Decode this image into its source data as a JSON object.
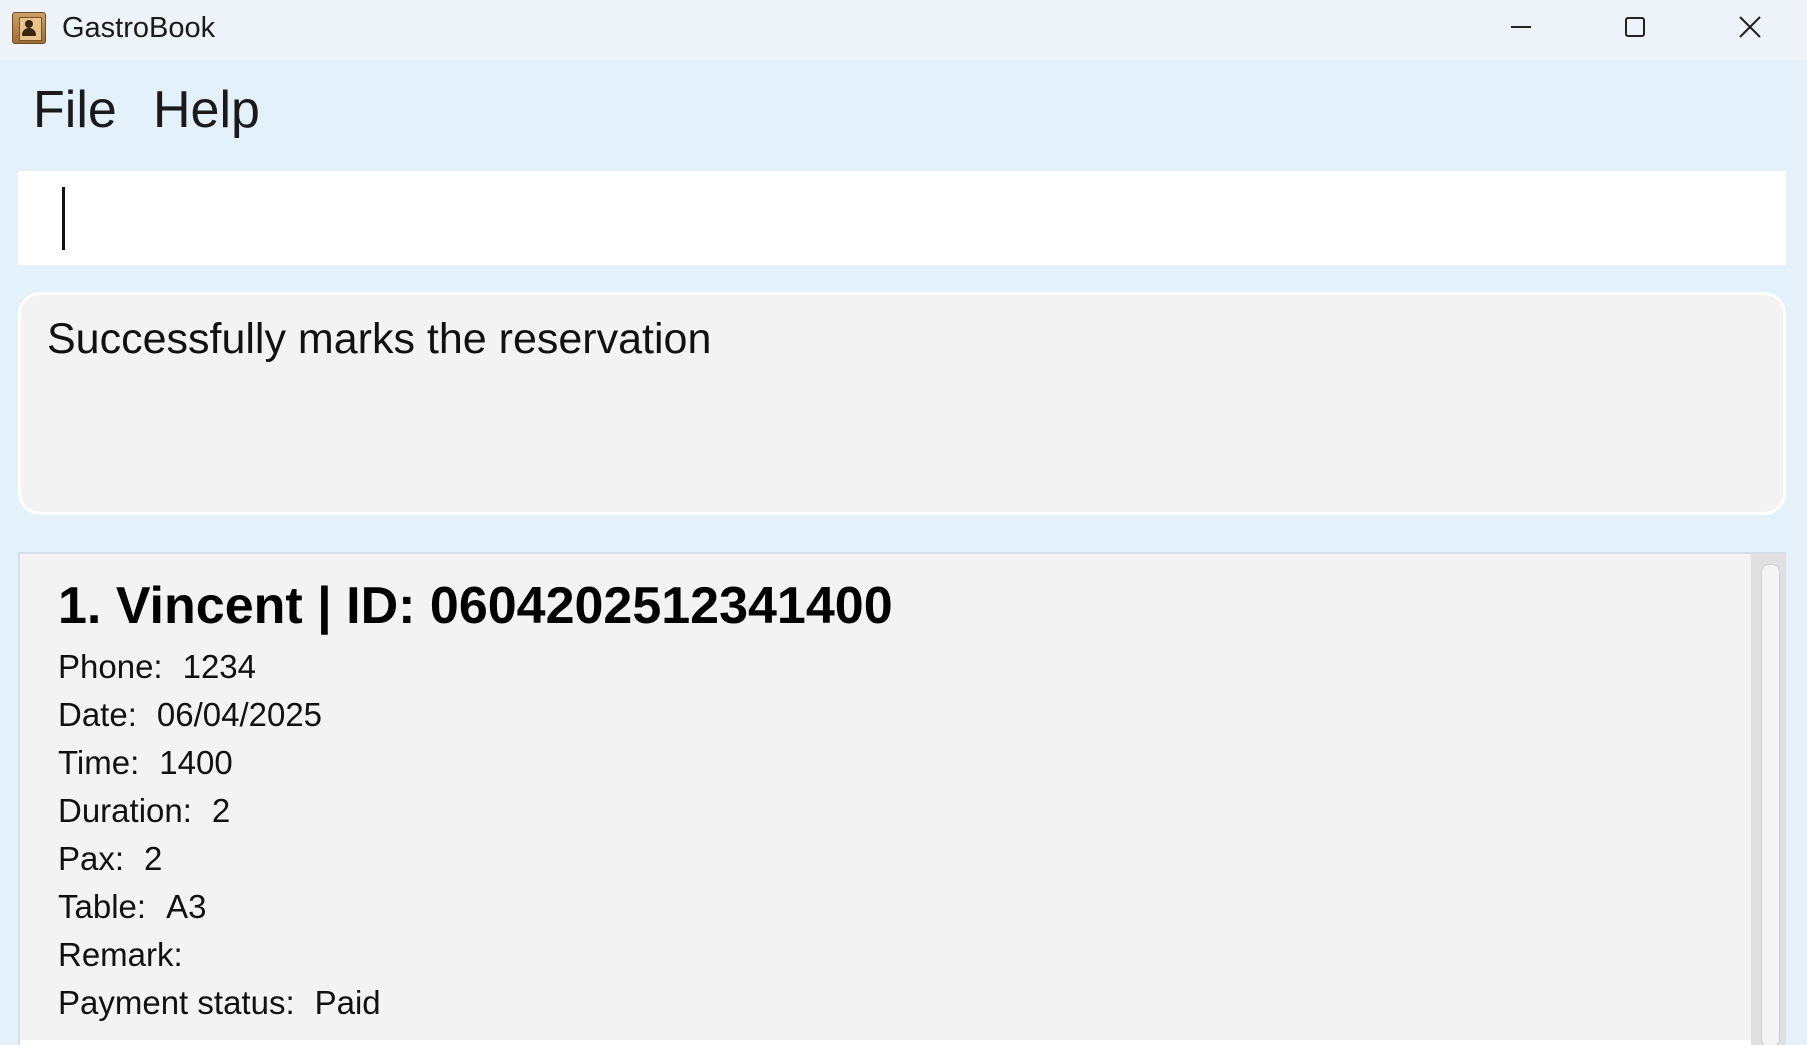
{
  "window": {
    "title": "GastroBook",
    "app_icon": "address-book-icon",
    "controls": [
      "minimize-icon",
      "maximize-icon",
      "close-icon"
    ]
  },
  "menu": {
    "items": [
      {
        "label": "File"
      },
      {
        "label": "Help"
      }
    ]
  },
  "command": {
    "value": "",
    "placeholder": ""
  },
  "result": {
    "message": "Successfully marks the reservation"
  },
  "reservations": [
    {
      "title": "1. Vincent | ID: 0604202512341400",
      "fields": [
        {
          "label": "Phone:",
          "value": "1234"
        },
        {
          "label": "Date:",
          "value": "06/04/2025"
        },
        {
          "label": "Time:",
          "value": "1400"
        },
        {
          "label": "Duration:",
          "value": "2"
        },
        {
          "label": "Pax:",
          "value": "2"
        },
        {
          "label": "Table:",
          "value": "A3"
        },
        {
          "label": "Remark:",
          "value": ""
        },
        {
          "label": "Payment status:",
          "value": "Paid"
        }
      ]
    }
  ],
  "colors": {
    "window_background": "#e4f1fb",
    "titlebar_background": "#eef3f9",
    "panel_background": "#f3f3f3",
    "command_background": "#ffffff"
  }
}
